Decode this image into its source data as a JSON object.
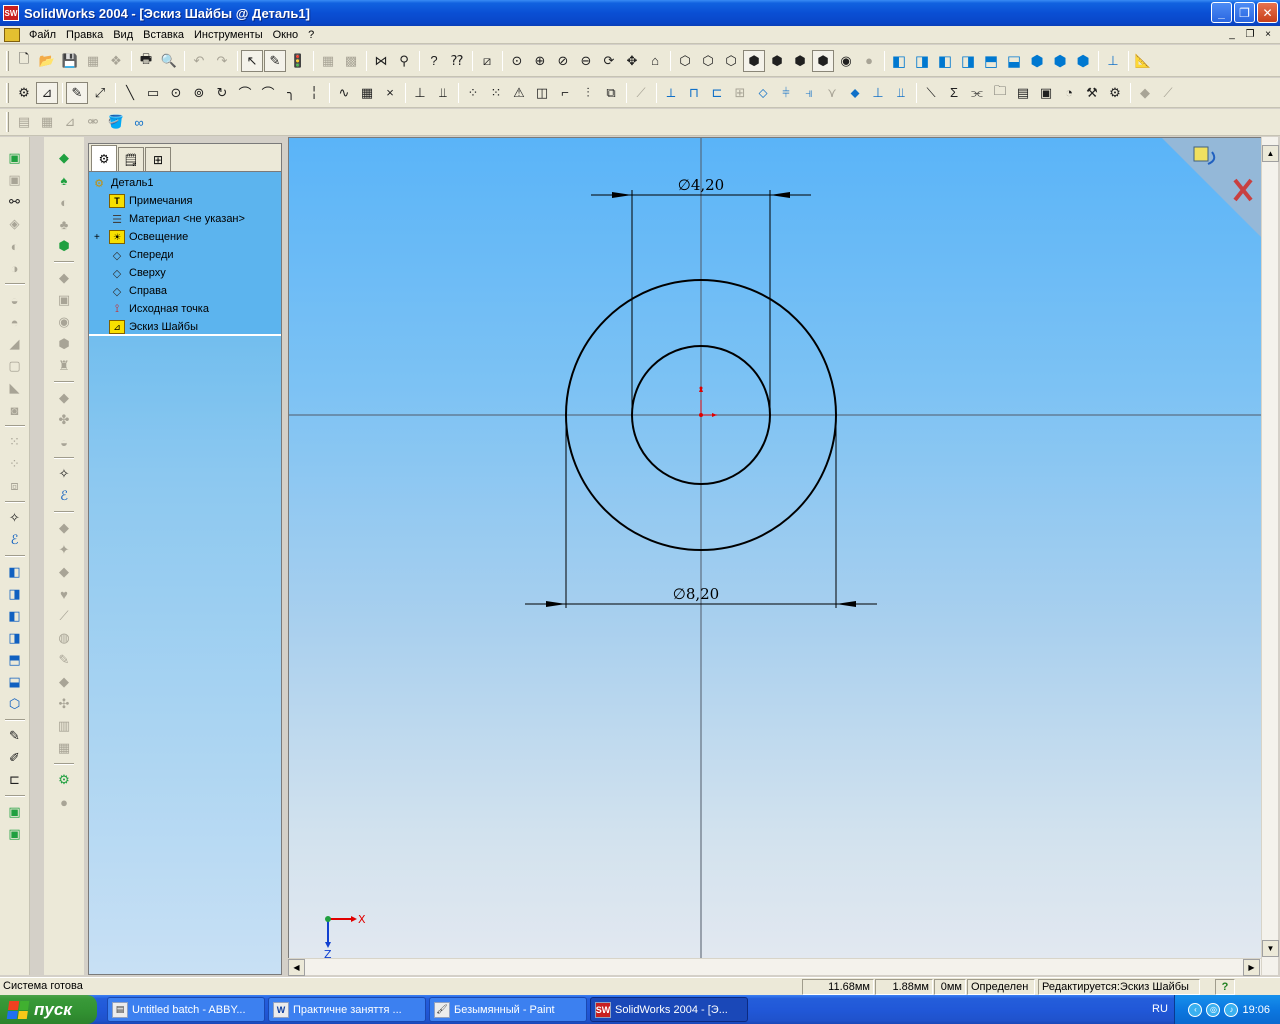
{
  "window": {
    "app_icon": "SW",
    "title": "SolidWorks 2004 - [Эскиз Шайбы @ Деталь1]",
    "minimize": "_",
    "maximize": "❐",
    "close": "✕"
  },
  "menu": {
    "items": [
      "Файл",
      "Правка",
      "Вид",
      "Вставка",
      "Инструменты",
      "Окно",
      "?"
    ],
    "mdi_buttons": [
      "_",
      "❐",
      "×"
    ]
  },
  "feature_manager": {
    "tabs": [
      "feature-tree-icon",
      "property-manager-icon",
      "configuration-manager-icon"
    ],
    "items": [
      {
        "label": "Деталь1",
        "icon": "part-icon",
        "indent": 0
      },
      {
        "label": "Примечания",
        "icon": "annotations-icon",
        "indent": 1
      },
      {
        "label": "Материал <не указан>",
        "icon": "material-icon",
        "indent": 1
      },
      {
        "label": "Освещение",
        "icon": "lighting-icon",
        "indent": 1,
        "expandable": true,
        "expand_glyph": "+"
      },
      {
        "label": "Спереди",
        "icon": "plane-icon",
        "indent": 1
      },
      {
        "label": "Сверху",
        "icon": "plane-icon",
        "indent": 1
      },
      {
        "label": "Справа",
        "icon": "plane-icon",
        "indent": 1
      },
      {
        "label": "Исходная точка",
        "icon": "origin-icon",
        "indent": 1
      },
      {
        "label": "Эскиз Шайбы",
        "icon": "sketch-icon",
        "indent": 1
      }
    ]
  },
  "sketch": {
    "dimension_inner": "∅4,20",
    "dimension_outer": "∅8,20",
    "axis_x": "X",
    "axis_z": "Z"
  },
  "status": {
    "message": "Система готова",
    "x": "11.68мм",
    "y": "1.88мм",
    "z": "0мм",
    "state": "Определен",
    "editing": "Редактируется:Эскиз Шайбы",
    "help": "?"
  },
  "taskbar": {
    "start_label": "пуск",
    "buttons": [
      {
        "label": "Untitled batch - ABBY...",
        "icon": "abbyy-icon",
        "active": false
      },
      {
        "label": "Практичне заняття ...",
        "icon": "word-icon",
        "active": false
      },
      {
        "label": "Безымянный - Paint",
        "icon": "paint-icon",
        "active": false
      },
      {
        "label": "SolidWorks 2004 - [Э...",
        "icon": "solidworks-icon",
        "active": true
      }
    ],
    "language": "RU",
    "clock": "19:06"
  },
  "colors": {
    "title_blue": "#0a4fd4",
    "graphics_top": "#5ab4f8",
    "graphics_bottom": "#e2e8f0",
    "sketch_line": "#000000",
    "origin_red": "#e00000"
  }
}
